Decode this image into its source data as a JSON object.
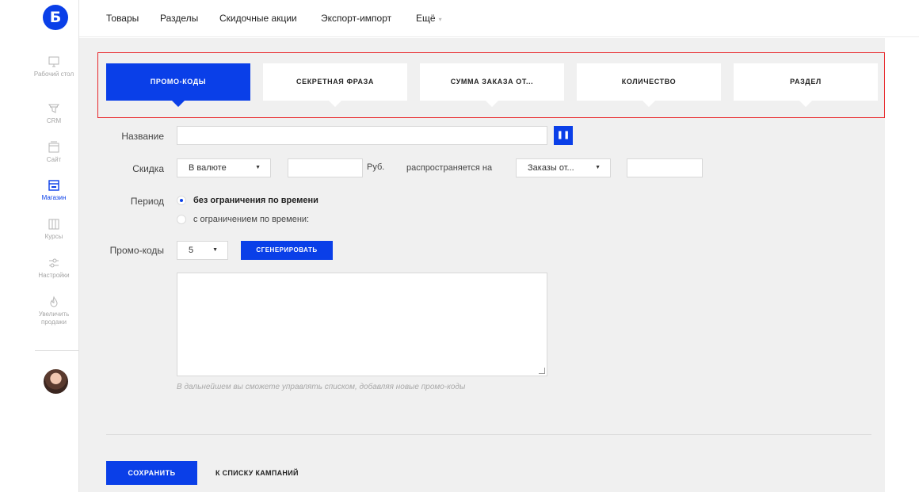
{
  "logo": {
    "letter": "Б"
  },
  "sidebar": {
    "items": [
      {
        "label": "Рабочий стол",
        "icon": "monitor-icon"
      },
      {
        "label": "CRM",
        "icon": "funnel-icon"
      },
      {
        "label": "Сайт",
        "icon": "site-icon"
      },
      {
        "label": "Магазин",
        "icon": "store-icon",
        "active": true
      },
      {
        "label": "Курсы",
        "icon": "courses-icon"
      },
      {
        "label": "Настройки",
        "icon": "sliders-icon"
      },
      {
        "label": "Увеличить продажи",
        "icon": "flame-icon"
      }
    ]
  },
  "topnav": {
    "items": [
      "Товары",
      "Разделы",
      "Скидочные акции",
      "Экспорт-импорт",
      "Ещё"
    ],
    "more_caret": "▾"
  },
  "tabs": [
    {
      "label": "ПРОМО-КОДЫ",
      "active": true
    },
    {
      "label": "СЕКРЕТНАЯ ФРАЗА"
    },
    {
      "label": "СУММА ЗАКАЗА ОТ..."
    },
    {
      "label": "КОЛИЧЕСТВО"
    },
    {
      "label": "РАЗДЕЛ"
    }
  ],
  "form": {
    "name_label": "Название",
    "name_value": "",
    "pause_glyph": "❚❚",
    "discount_label": "Скидка",
    "discount_type": "В валюте",
    "discount_value": "",
    "currency": "Руб.",
    "applies_to_label": "распространяется на",
    "applies_to_value": "Заказы от...",
    "applies_amount": "",
    "period_label": "Период",
    "period_option_1": "без ограничения по времени",
    "period_option_2": "с ограничением по времени:",
    "promo_label": "Промо-коды",
    "promo_count": "5",
    "generate_button": "СГЕНЕРИРОВАТЬ",
    "codes_text": "",
    "hint": "В дальнейшем вы сможете управлять списком, добавляя новые промо-коды"
  },
  "footer": {
    "save_button": "СОХРАНИТЬ",
    "back_link": "К СПИСКУ КАМПАНИЙ"
  },
  "colors": {
    "accent": "#0a3fe8",
    "highlight_frame": "#e8262a",
    "background": "#f0f0f0"
  },
  "select_caret": "▼"
}
